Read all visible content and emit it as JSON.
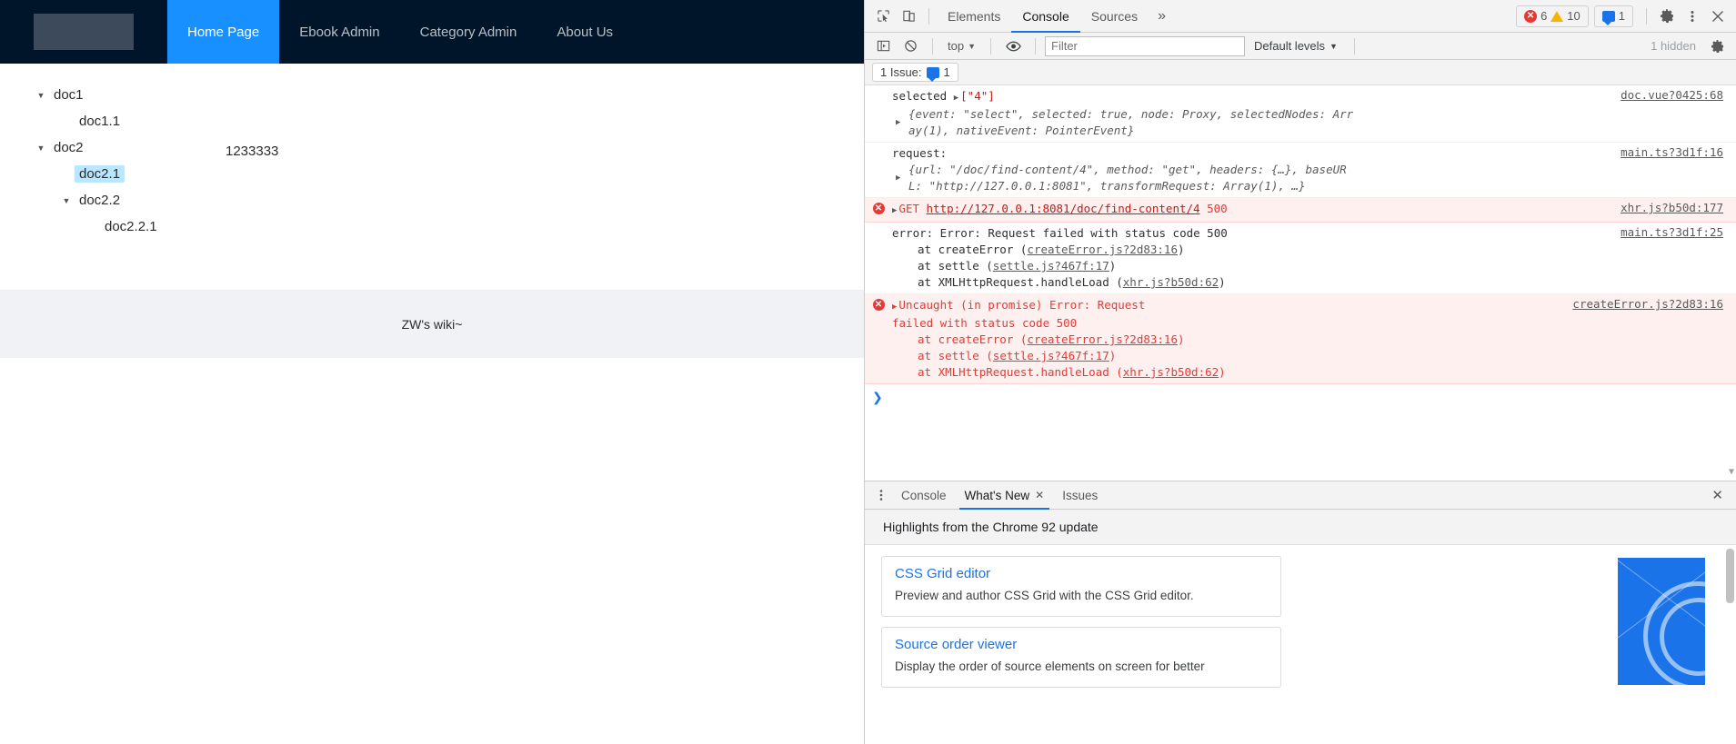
{
  "webpage": {
    "nav": {
      "logo_name": "site-logo",
      "items": [
        {
          "label": "Home Page",
          "active": true
        },
        {
          "label": "Ebook Admin",
          "active": false
        },
        {
          "label": "Category Admin",
          "active": false
        },
        {
          "label": "About Us",
          "active": false
        }
      ]
    },
    "tree": [
      {
        "label": "doc1",
        "depth": 0,
        "caret": "▼",
        "selected": false
      },
      {
        "label": "doc1.1",
        "depth": 1,
        "caret": "",
        "selected": false
      },
      {
        "label": "doc2",
        "depth": 0,
        "caret": "▼",
        "selected": false
      },
      {
        "label": "doc2.1",
        "depth": 1,
        "caret": "",
        "selected": true
      },
      {
        "label": "doc2.2",
        "depth": 1,
        "caret": "▼",
        "selected": false
      },
      {
        "label": "doc2.2.1",
        "depth": 2,
        "caret": "",
        "selected": false
      }
    ],
    "content_title": "1233333",
    "footer_text": "ZW's wiki~"
  },
  "devtools": {
    "toolbar": {
      "inspect_icon": "inspect-element-icon",
      "device_icon": "device-toolbar-icon",
      "tabs": [
        {
          "label": "Elements",
          "active": false
        },
        {
          "label": "Console",
          "active": true
        },
        {
          "label": "Sources",
          "active": false
        }
      ],
      "more_tabs": "»",
      "error_count": "6",
      "warning_count": "10",
      "message_count": "1",
      "settings_icon": "gear-icon",
      "kebab_icon": "more-options-icon",
      "close_icon": "close-icon"
    },
    "filterbar": {
      "sidebar_icon": "console-sidebar-icon",
      "clear_icon": "clear-console-icon",
      "context": "top",
      "eye_icon": "live-expression-icon",
      "filter_placeholder": "Filter",
      "filter_value": "",
      "levels": "Default levels",
      "hidden": "1 hidden",
      "settings_icon": "console-settings-icon"
    },
    "issue_bar": {
      "label": "1 Issue:",
      "count": "1"
    },
    "console_messages": [
      {
        "type": "log",
        "lines": [
          {
            "kind": "mixed",
            "parts": [
              {
                "t": "plain",
                "v": "selected "
              },
              {
                "t": "tri",
                "v": "▶"
              },
              {
                "t": "str",
                "v": "[\"4\"]"
              }
            ]
          },
          {
            "kind": "object",
            "v": "{event: \"select\", selected: true, node: Proxy, selectedNodes: Arr"
          },
          {
            "kind": "object",
            "v": "ay(1), nativeEvent: PointerEvent}"
          }
        ],
        "source": "doc.vue?0425:68"
      },
      {
        "type": "log",
        "lines": [
          {
            "kind": "mixed",
            "parts": [
              {
                "t": "plain",
                "v": "request:"
              }
            ]
          },
          {
            "kind": "object",
            "v": "{url: \"/doc/find-content/4\", method: \"get\", headers: {…}, baseUR"
          },
          {
            "kind": "object",
            "v": "L: \"http://127.0.0.1:8081\", transformRequest: Array(1), …}"
          }
        ],
        "source": "main.ts?3d1f:16"
      },
      {
        "type": "network-error",
        "method": "GET",
        "url": "http://127.0.0.1:8081/doc/find-content/4",
        "status": "500",
        "source": "xhr.js?b50d:177"
      },
      {
        "type": "error-log",
        "headline": "error:  Error: Request failed with status code 500",
        "source": "main.ts?3d1f:25",
        "stack": [
          {
            "text": "at createError (",
            "link": "createError.js?2d83:16",
            "tail": ")"
          },
          {
            "text": "at settle (",
            "link": "settle.js?467f:17",
            "tail": ")"
          },
          {
            "text": "at XMLHttpRequest.handleLoad (",
            "link": "xhr.js?b50d:62",
            "tail": ")"
          }
        ]
      },
      {
        "type": "uncaught-error",
        "headline_line1": "Uncaught (in promise) Error: Request",
        "headline_line2": "failed with status code 500",
        "source": "createError.js?2d83:16",
        "stack": [
          {
            "text": "at createError (",
            "link": "createError.js?2d83:16",
            "tail": ")"
          },
          {
            "text": "at settle (",
            "link": "settle.js?467f:17",
            "tail": ")"
          },
          {
            "text": "at XMLHttpRequest.handleLoad (",
            "link": "xhr.js?b50d:62",
            "tail": ")"
          }
        ]
      }
    ],
    "prompt_caret": "❯",
    "drawer": {
      "kebab_icon": "drawer-more-options-icon",
      "tabs": [
        {
          "label": "Console",
          "active": false,
          "closable": false
        },
        {
          "label": "What's New",
          "active": true,
          "closable": true
        },
        {
          "label": "Issues",
          "active": false,
          "closable": false
        }
      ],
      "close_icon": "close-drawer-icon",
      "whats_new": {
        "header": "Highlights from the Chrome 92 update",
        "cards": [
          {
            "title": "CSS Grid editor",
            "desc": "Preview and author CSS Grid with the CSS Grid editor."
          },
          {
            "title": "Source order viewer",
            "desc": "Display the order of source elements on screen for better"
          }
        ]
      }
    },
    "colors": {
      "accent": "#1a73e8",
      "error": "#e53935",
      "warning": "#f5b400",
      "nav_bg": "#001529",
      "nav_active": "#1890ff",
      "tree_selected": "#bae7ff"
    }
  }
}
